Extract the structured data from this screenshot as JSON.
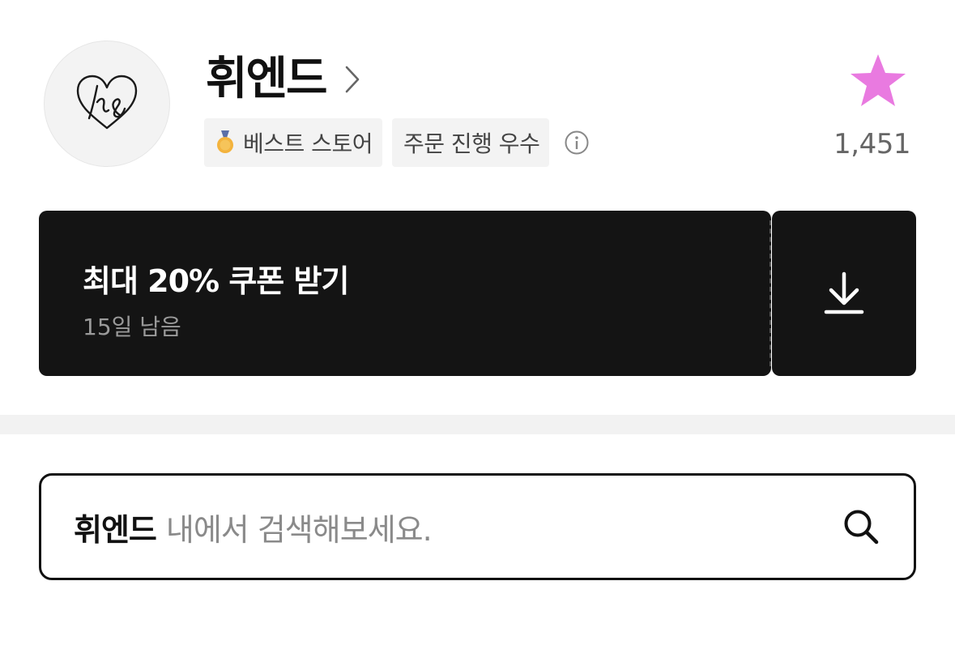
{
  "store": {
    "name": "휘엔드",
    "logo_icon": "heart-monogram-logo-icon",
    "favorite_icon": "star-icon",
    "favorite_color": "#e97ae0",
    "favorite_count": "1,451"
  },
  "badges": [
    {
      "label": "베스트 스토어",
      "icon": "medal-icon"
    },
    {
      "label": "주문 진행 우수"
    }
  ],
  "info_icon": "info-icon",
  "coupon": {
    "title": "최대 20% 쿠폰 받기",
    "subtitle": "15일 남음",
    "download_icon": "download-icon",
    "background": "#141414"
  },
  "search": {
    "store_name": "휘엔드",
    "placeholder": "내에서 검색해보세요.",
    "icon": "search-icon"
  }
}
